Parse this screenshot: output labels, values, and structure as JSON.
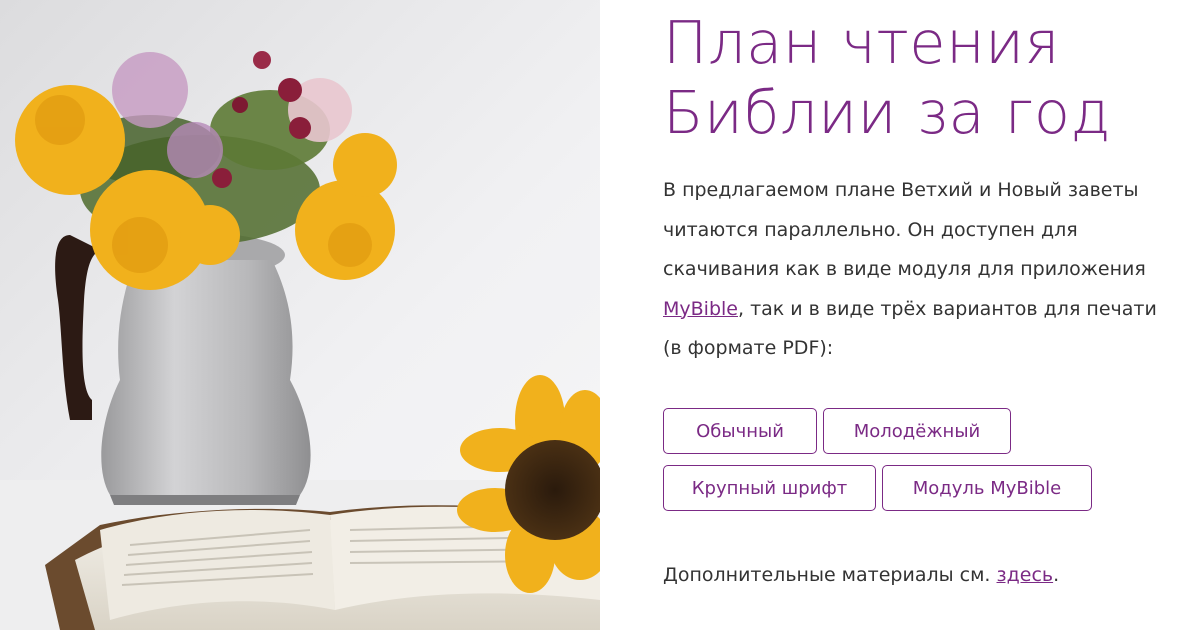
{
  "photo": {
    "icons": [
      "sunflower-bouquet",
      "metal-pitcher",
      "open-bible"
    ]
  },
  "title": {
    "line1": "План чтения",
    "line2": "Библии за год"
  },
  "description": {
    "before_link": "В предлагаемом плане Ветхий и Новый заветы читаются параллельно. Он доступен для скачивания как в виде модуля для приложения ",
    "link_text": "MyBible",
    "after_link": ", так и в виде трёх вариантов для печати (в формате PDF):"
  },
  "buttons": {
    "regular": "Обычный",
    "youth": "Молодёжный",
    "large_font": "Крупный шрифт",
    "mybible_module": "Модуль MyBible"
  },
  "footer": {
    "before_link": "Дополнительные материалы см. ",
    "link_text": "здесь",
    "after_link": "."
  },
  "colors": {
    "accent": "#7b2a85",
    "text": "#333333",
    "sunflower": "#f1b11c"
  }
}
